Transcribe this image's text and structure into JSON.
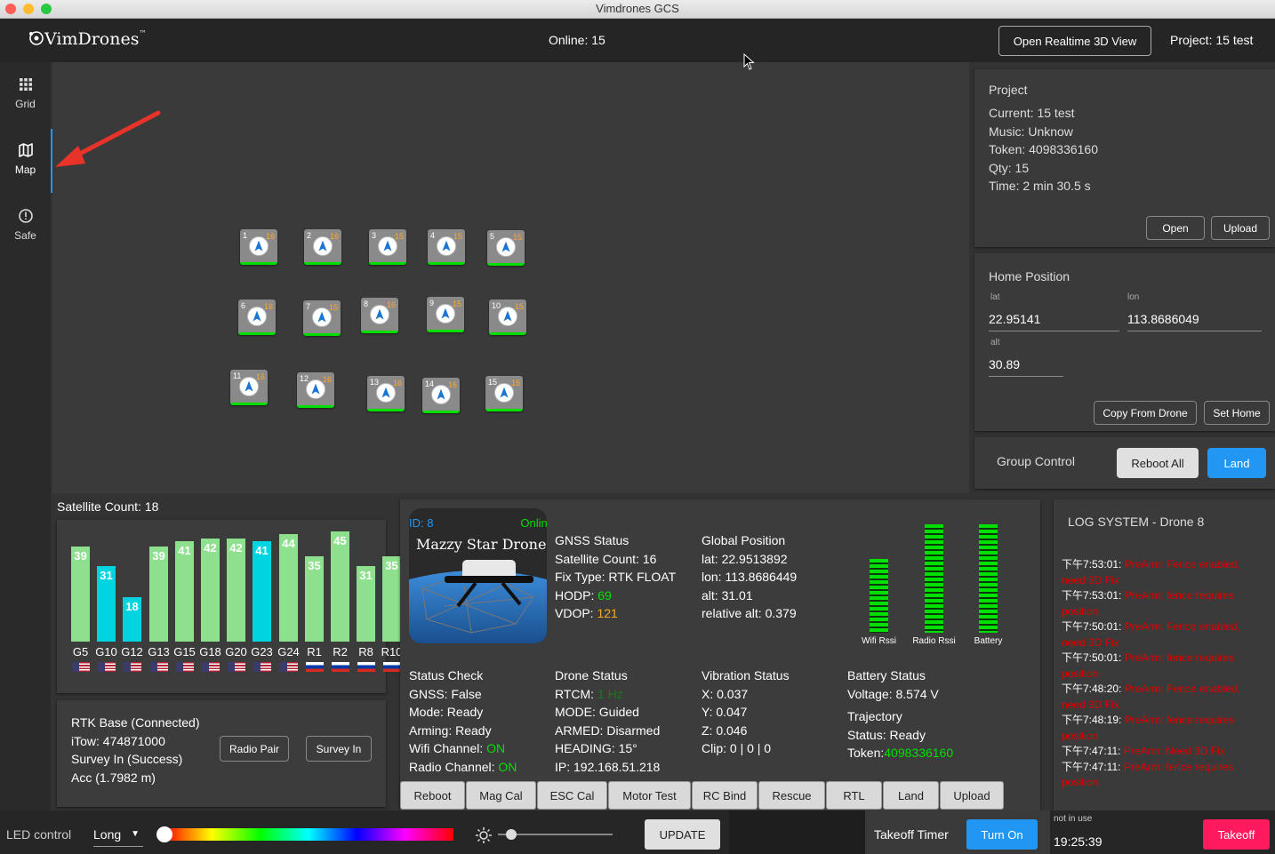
{
  "window": {
    "title": "Vimdrones GCS"
  },
  "appbar": {
    "logo": "VimDrones",
    "logo_tm": "™",
    "online": "Online: 15",
    "open_3d_label": "Open Realtime 3D View",
    "project": "Project: 15 test"
  },
  "sidebar": {
    "items": [
      {
        "label": "Grid",
        "icon": "grid-icon"
      },
      {
        "label": "Map",
        "icon": "map-icon"
      },
      {
        "label": "Safe",
        "icon": "alert-circle-icon"
      }
    ]
  },
  "drones": [
    {
      "id": "1",
      "sat": "16"
    },
    {
      "id": "2",
      "sat": "16"
    },
    {
      "id": "3",
      "sat": "15"
    },
    {
      "id": "4",
      "sat": "15"
    },
    {
      "id": "5",
      "sat": "15"
    },
    {
      "id": "6",
      "sat": "16"
    },
    {
      "id": "7",
      "sat": "15"
    },
    {
      "id": "8",
      "sat": "16"
    },
    {
      "id": "9",
      "sat": "15"
    },
    {
      "id": "10",
      "sat": "15"
    },
    {
      "id": "11",
      "sat": "16"
    },
    {
      "id": "12",
      "sat": "16"
    },
    {
      "id": "13",
      "sat": "16"
    },
    {
      "id": "14",
      "sat": "16"
    },
    {
      "id": "15",
      "sat": "15"
    }
  ],
  "project_panel": {
    "title": "Project",
    "current": "Current: 15 test",
    "music": "Music: Unknow",
    "token": "Token: 4098336160",
    "qty": "Qty: 15",
    "time": "Time: 2 min 30.5 s",
    "open_label": "Open",
    "upload_label": "Upload"
  },
  "home_panel": {
    "title": "Home Position",
    "lat_label": "lat",
    "lat": "22.95141",
    "lon_label": "lon",
    "lon": "113.8686049",
    "alt_label": "alt",
    "alt": "30.89",
    "copy_label": "Copy From Drone",
    "set_label": "Set Home"
  },
  "group_panel": {
    "title": "Group Control",
    "reboot_label": "Reboot All",
    "land_label": "Land"
  },
  "satellites": {
    "title": "Satellite Count: 18",
    "bars": [
      {
        "label": "G5",
        "value": 39,
        "color": "#8ee08e",
        "flag": "us"
      },
      {
        "label": "G10",
        "value": 31,
        "color": "#00d4e0",
        "flag": "us"
      },
      {
        "label": "G12",
        "value": 18,
        "color": "#00d4e0",
        "flag": "us"
      },
      {
        "label": "G13",
        "value": 39,
        "color": "#8ee08e",
        "flag": "us"
      },
      {
        "label": "G15",
        "value": 41,
        "color": "#8ee08e",
        "flag": "us"
      },
      {
        "label": "G18",
        "value": 42,
        "color": "#8ee08e",
        "flag": "us"
      },
      {
        "label": "G20",
        "value": 42,
        "color": "#8ee08e",
        "flag": "us"
      },
      {
        "label": "G23",
        "value": 41,
        "color": "#00d4e0",
        "flag": "us"
      },
      {
        "label": "G24",
        "value": 44,
        "color": "#8ee08e",
        "flag": "us"
      },
      {
        "label": "R1",
        "value": 35,
        "color": "#8ee08e",
        "flag": "ru"
      },
      {
        "label": "R2",
        "value": 45,
        "color": "#8ee08e",
        "flag": "ru"
      },
      {
        "label": "R8",
        "value": 31,
        "color": "#8ee08e",
        "flag": "ru"
      },
      {
        "label": "R10",
        "value": 35,
        "color": "#8ee08e",
        "flag": "ru"
      }
    ]
  },
  "rtk": {
    "title": "RTK Base (Connected)",
    "itow": "iTow: 474871000",
    "survey": "Survey In (Success)",
    "acc": "Acc (1.7982 m)",
    "radio_pair_label": "Radio Pair",
    "survey_in_label": "Survey In"
  },
  "drone_detail": {
    "id": "ID: 8",
    "status": "Online",
    "name": "Mazzy Star Drone",
    "gnss": {
      "title": "GNSS Status",
      "sat": "Satellite Count: 16",
      "fix": "Fix Type: RTK FLOAT",
      "hodp_label": "HODP: ",
      "hodp": "69",
      "vdop_label": "VDOP: ",
      "vdop": "121"
    },
    "global": {
      "title": "Global Position",
      "lat": "lat: 22.9513892",
      "lon": "lon: 113.8686449",
      "alt": "alt: 31.01",
      "rel": "relative alt: 0.379"
    },
    "signal_bars": [
      {
        "label": "Wifi Rssi",
        "level": 0.68
      },
      {
        "label": "Radio Rssi",
        "level": 1.0
      },
      {
        "label": "Battery",
        "level": 1.0
      }
    ],
    "status_check": {
      "title": "Status Check",
      "gnss": "GNSS: False",
      "mode": "Mode: Ready",
      "arming": "Arming: Ready",
      "wifi_label": "Wifi Channel: ",
      "wifi": "ON",
      "radio_label": "Radio Channel: ",
      "radio": "ON"
    },
    "drone_status": {
      "title": "Drone Status",
      "rtcm_label": "RTCM: ",
      "rtcm": "1 Hz",
      "mode": "MODE: Guided",
      "armed": "ARMED: Disarmed",
      "heading": "HEADING: 15°",
      "ip": "IP: 192.168.51.218"
    },
    "vibration": {
      "title": "Vibration Status",
      "x": "X: 0.037",
      "y": "Y: 0.047",
      "z": "Z: 0.046",
      "clip": "Clip: 0 | 0 | 0"
    },
    "battery": {
      "title": "Battery Status",
      "voltage": "Voltage: 8.574 V"
    },
    "trajectory": {
      "title": "Trajectory",
      "status": "Status: Ready",
      "token_label": "Token:",
      "token": "4098336160"
    },
    "buttons": [
      "Reboot",
      "Mag Cal",
      "ESC Cal",
      "Motor Test",
      "RC Bind",
      "Rescue",
      "RTL",
      "Land",
      "Upload"
    ]
  },
  "log": {
    "title": "LOG SYSTEM - Drone 8",
    "entries": [
      {
        "time": "下午7:53:01: ",
        "msg": "PreArm: Fence enabled,",
        "cont": "need 3D Fix"
      },
      {
        "time": "下午7:53:01: ",
        "msg": "PreArm: fence requires",
        "cont": "position"
      },
      {
        "time": "下午7:50:01: ",
        "msg": "PreArm: Fence enabled,",
        "cont": "need 3D Fix"
      },
      {
        "time": "下午7:50:01: ",
        "msg": "PreArm: fence requires",
        "cont": "position"
      },
      {
        "time": "下午7:48:20: ",
        "msg": "PreArm: Fence enabled,",
        "cont": "need 3D Fix"
      },
      {
        "time": "下午7:48:19: ",
        "msg": "PreArm: fence requires",
        "cont": "position"
      },
      {
        "time": "下午7:47:11: ",
        "msg": "PreArm: Need 3D Fix",
        "cont": ""
      },
      {
        "time": "下午7:47:11: ",
        "msg": "PreArm: fence requires",
        "cont": "position"
      }
    ]
  },
  "bottombar": {
    "led_label": "LED control",
    "led_mode": "Long",
    "hue_position": 0.0,
    "brightness_level": 0.12,
    "update_label": "UPDATE",
    "takeoff_timer_label": "Takeoff Timer",
    "turn_on_label": "Turn On",
    "not_in_use": "not in use",
    "clock": "19:25:39",
    "takeoff_label": "Takeoff"
  }
}
